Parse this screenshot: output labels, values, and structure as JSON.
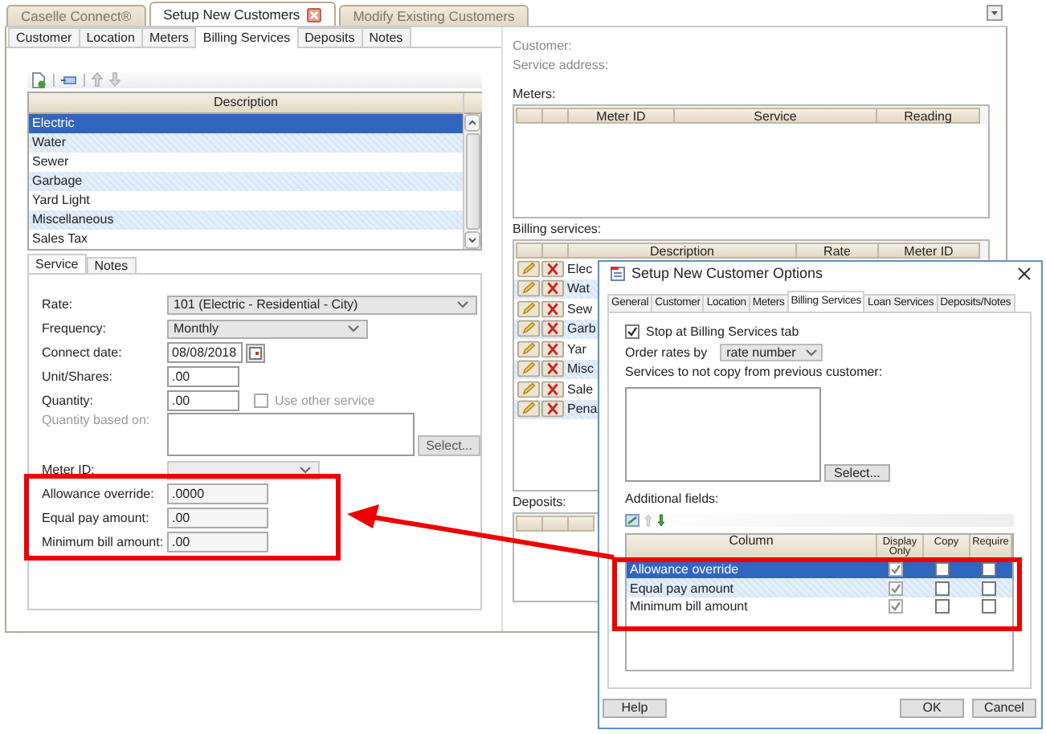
{
  "app_tabs": [
    {
      "label": "Caselle Connect®",
      "selected": false,
      "closable": false
    },
    {
      "label": "Setup New Customers",
      "selected": true,
      "closable": true
    },
    {
      "label": "Modify Existing Customers",
      "selected": false,
      "closable": false
    }
  ],
  "page_tabs": [
    {
      "label": "Customer",
      "selected": false
    },
    {
      "label": "Location",
      "selected": false
    },
    {
      "label": "Meters",
      "selected": false
    },
    {
      "label": "Billing Services",
      "selected": true
    },
    {
      "label": "Deposits",
      "selected": false
    },
    {
      "label": "Notes",
      "selected": false
    }
  ],
  "services_list": {
    "column": "Description",
    "rows": [
      {
        "label": "Electric",
        "selected": true
      },
      {
        "label": "Water",
        "selected": false
      },
      {
        "label": "Sewer",
        "selected": false
      },
      {
        "label": "Garbage",
        "selected": false
      },
      {
        "label": "Yard Light",
        "selected": false
      },
      {
        "label": "Miscellaneous",
        "selected": false
      },
      {
        "label": "Sales Tax",
        "selected": false
      }
    ]
  },
  "detail_tabs": [
    {
      "label": "Service",
      "selected": true
    },
    {
      "label": "Notes",
      "selected": false
    }
  ],
  "form": [
    {
      "kind": "select",
      "label": "Rate:",
      "value": "101 (Electric - Residential - City)",
      "disabled": false
    },
    {
      "kind": "select",
      "label": "Frequency:",
      "value": "Monthly",
      "disabled": false
    },
    {
      "kind": "date",
      "label": "Connect date:",
      "value": "08/08/2018"
    },
    {
      "kind": "input",
      "label": "Unit/Shares:",
      "value": ".00"
    },
    {
      "kind": "input_check",
      "label": "Quantity:",
      "value": ".00",
      "check_label": "Use other service",
      "checked": false
    },
    {
      "kind": "textarea",
      "label": "Quantity based on:",
      "disabled": true,
      "button": "Select..."
    },
    {
      "kind": "select",
      "label": "Meter ID:",
      "disabled": true
    }
  ],
  "additional_fields": [
    {
      "label": "Allowance override:",
      "value": ".0000"
    },
    {
      "label": "Equal pay amount:",
      "value": ".00"
    },
    {
      "label": "Minimum bill amount:",
      "value": ".00"
    }
  ],
  "customer_info": [
    "Customer:",
    "Service address:"
  ],
  "meters": {
    "label": "Meters:",
    "columns": [
      "Meter ID",
      "Service",
      "Reading"
    ]
  },
  "billing_services": {
    "label": "Billing services:",
    "columns": [
      "Description",
      "Rate",
      "Meter ID"
    ],
    "rows": [
      {
        "description": "Elec"
      },
      {
        "description": "Wat"
      },
      {
        "description": "Sew"
      },
      {
        "description": "Garb"
      },
      {
        "description": "Yar"
      },
      {
        "description": "Misc"
      },
      {
        "description": "Sale"
      },
      {
        "description": "Pena"
      }
    ]
  },
  "deposits": {
    "label": "Deposits:"
  },
  "dialog": {
    "title": "Setup New Customer Options",
    "tabs": [
      {
        "label": "General",
        "selected": false
      },
      {
        "label": "Customer",
        "selected": false
      },
      {
        "label": "Location",
        "selected": false
      },
      {
        "label": "Meters",
        "selected": false
      },
      {
        "label": "Billing Services",
        "selected": true
      },
      {
        "label": "Loan Services",
        "selected": false
      },
      {
        "label": "Deposits/Notes",
        "selected": false
      }
    ],
    "stop_checkbox": {
      "label": "Stop at Billing Services tab",
      "checked": true
    },
    "order_label": "Order rates by",
    "order_value": "rate number",
    "services_label": "Services to not copy from previous customer:",
    "select_button": "Select...",
    "additional_label": "Additional fields:",
    "columns": [
      "Column",
      "Display Only",
      "Copy",
      "Require"
    ],
    "rows": [
      {
        "label": "Allowance override",
        "selected": true,
        "display_only": true,
        "copy": false,
        "require": false
      },
      {
        "label": "Equal pay amount",
        "selected": false,
        "display_only": true,
        "copy": false,
        "require": false
      },
      {
        "label": "Minimum bill amount",
        "selected": false,
        "display_only": true,
        "copy": false,
        "require": false
      }
    ],
    "buttons": [
      {
        "label": "Help",
        "kind": "left"
      },
      {
        "label": "OK",
        "kind": "right"
      },
      {
        "label": "Cancel",
        "kind": "right"
      }
    ]
  }
}
